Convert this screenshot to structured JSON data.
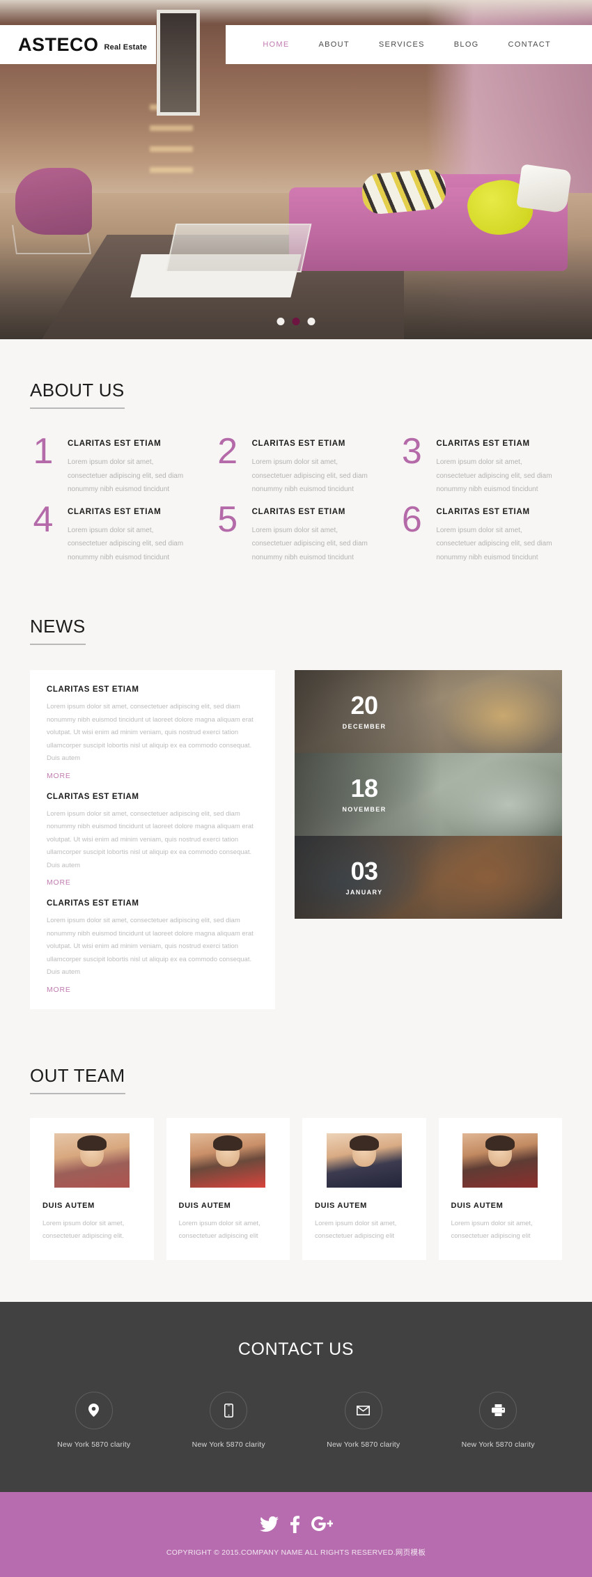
{
  "brand": {
    "logo_main": "ASTECO",
    "logo_sub": "Real Estate"
  },
  "nav": {
    "items": [
      {
        "label": "HOME",
        "active": true
      },
      {
        "label": "ABOUT",
        "active": false
      },
      {
        "label": "SERVICES",
        "active": false
      },
      {
        "label": "BLOG",
        "active": false
      },
      {
        "label": "CONTACT",
        "active": false
      }
    ]
  },
  "hero": {
    "slider_dots": 3,
    "active_dot_index": 1
  },
  "about": {
    "title": "ABOUT US",
    "features": [
      {
        "num": "1",
        "heading": "CLARITAS EST ETIAM",
        "text": "Lorem ipsum dolor sit amet, consectetuer adipiscing elit, sed diam nonummy nibh euismod tincidunt"
      },
      {
        "num": "2",
        "heading": "CLARITAS EST ETIAM",
        "text": "Lorem ipsum dolor sit amet, consectetuer adipiscing elit, sed diam nonummy nibh euismod tincidunt"
      },
      {
        "num": "3",
        "heading": "CLARITAS EST ETIAM",
        "text": "Lorem ipsum dolor sit amet, consectetuer adipiscing elit, sed diam nonummy nibh euismod tincidunt"
      },
      {
        "num": "4",
        "heading": "CLARITAS EST ETIAM",
        "text": "Lorem ipsum dolor sit amet, consectetuer adipiscing elit, sed diam nonummy nibh euismod tincidunt"
      },
      {
        "num": "5",
        "heading": "CLARITAS EST ETIAM",
        "text": "Lorem ipsum dolor sit amet, consectetuer adipiscing elit, sed diam nonummy nibh euismod tincidunt"
      },
      {
        "num": "6",
        "heading": "CLARITAS EST ETIAM",
        "text": "Lorem ipsum dolor sit amet, consectetuer adipiscing elit, sed diam nonummy nibh euismod tincidunt"
      }
    ]
  },
  "news": {
    "title": "NEWS",
    "more_label": "MORE",
    "items": [
      {
        "heading": "CLARITAS EST ETIAM",
        "text": "Lorem ipsum dolor sit amet, consectetuer adipiscing elit, sed diam nonummy nibh euismod tincidunt ut laoreet dolore magna aliquam erat volutpat. Ut wisi enim ad minim veniam, quis nostrud exerci tation ullamcorper suscipit lobortis nisl ut aliquip ex ea commodo consequat. Duis autem"
      },
      {
        "heading": "CLARITAS EST ETIAM",
        "text": "Lorem ipsum dolor sit amet, consectetuer adipiscing elit, sed diam nonummy nibh euismod tincidunt ut laoreet dolore magna aliquam erat volutpat. Ut wisi enim ad minim veniam, quis nostrud exerci tation ullamcorper suscipit lobortis nisl ut aliquip ex ea commodo consequat. Duis autem"
      },
      {
        "heading": "CLARITAS EST ETIAM",
        "text": "Lorem ipsum dolor sit amet, consectetuer adipiscing elit, sed diam nonummy nibh euismod tincidunt ut laoreet dolore magna aliquam erat volutpat. Ut wisi enim ad minim veniam, quis nostrud exerci tation ullamcorper suscipit lobortis nisl ut aliquip ex ea commodo consequat. Duis autem"
      }
    ],
    "cards": [
      {
        "day": "20",
        "month": "DECEMBER"
      },
      {
        "day": "18",
        "month": "NOVEMBER"
      },
      {
        "day": "03",
        "month": "JANUARY"
      }
    ]
  },
  "team": {
    "title": "OUT TEAM",
    "members": [
      {
        "name": "DUIS AUTEM",
        "text": "Lorem ipsum dolor sit amet, consectetuer adipiscing elit."
      },
      {
        "name": "DUIS AUTEM",
        "text": "Lorem ipsum dolor sit amet, consectetuer adipiscing elit"
      },
      {
        "name": "DUIS AUTEM",
        "text": "Lorem ipsum dolor sit amet, consectetuer adipiscing elit"
      },
      {
        "name": "DUIS AUTEM",
        "text": "Lorem ipsum dolor sit amet, consectetuer adipiscing elit"
      }
    ]
  },
  "contact": {
    "title": "CONTACT US",
    "items": [
      {
        "icon": "map-pin-icon",
        "text": "New York 5870 clarity"
      },
      {
        "icon": "phone-icon",
        "text": "New York 5870 clarity"
      },
      {
        "icon": "envelope-icon",
        "text": "New York 5870 clarity"
      },
      {
        "icon": "printer-icon",
        "text": "New York 5870 clarity"
      }
    ]
  },
  "footer": {
    "social": [
      {
        "name": "twitter-icon",
        "label": "Twitter"
      },
      {
        "name": "facebook-icon",
        "label": "Facebook"
      },
      {
        "name": "google-plus-icon",
        "label": "Google Plus"
      }
    ],
    "copyright": "COPYRIGHT © 2015.COMPANY NAME ALL RIGHTS RESERVED.网页模板"
  },
  "colors": {
    "accent": "#b66cae",
    "accent_dark": "#6d1440",
    "dark_bar": "#414141",
    "light_bg": "#f7f6f4",
    "number": "#b46aa8"
  }
}
